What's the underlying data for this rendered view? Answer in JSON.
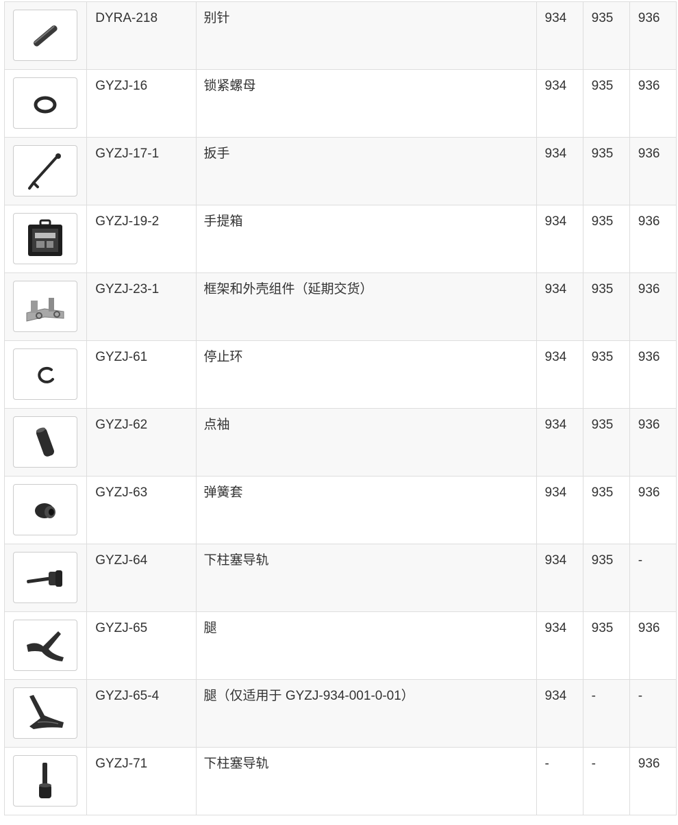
{
  "rows": [
    {
      "code": "DYRA-218",
      "name": "别针",
      "m934": "934",
      "m935": "935",
      "m936": "936",
      "icon": "pin-icon"
    },
    {
      "code": "GYZJ-16",
      "name": "锁紧螺母",
      "m934": "934",
      "m935": "935",
      "m936": "936",
      "icon": "lock-nut-icon"
    },
    {
      "code": "GYZJ-17-1",
      "name": "扳手",
      "m934": "934",
      "m935": "935",
      "m936": "936",
      "icon": "wrench-icon"
    },
    {
      "code": "GYZJ-19-2",
      "name": "手提箱",
      "m934": "934",
      "m935": "935",
      "m936": "936",
      "icon": "carry-case-icon"
    },
    {
      "code": "GYZJ-23-1",
      "name": "框架和外壳组件（延期交货）",
      "m934": "934",
      "m935": "935",
      "m936": "936",
      "icon": "frame-assembly-icon"
    },
    {
      "code": "GYZJ-61",
      "name": "停止环",
      "m934": "934",
      "m935": "935",
      "m936": "936",
      "icon": "stop-ring-icon"
    },
    {
      "code": "GYZJ-62",
      "name": "点袖",
      "m934": "934",
      "m935": "935",
      "m936": "936",
      "icon": "sleeve-icon"
    },
    {
      "code": "GYZJ-63",
      "name": "弹簧套",
      "m934": "934",
      "m935": "935",
      "m936": "936",
      "icon": "spring-sleeve-icon"
    },
    {
      "code": "GYZJ-64",
      "name": "下柱塞导轨",
      "m934": "934",
      "m935": "935",
      "m936": "-",
      "icon": "plunger-guide-icon"
    },
    {
      "code": "GYZJ-65",
      "name": "腿",
      "m934": "934",
      "m935": "935",
      "m936": "936",
      "icon": "leg-icon"
    },
    {
      "code": "GYZJ-65-4",
      "name": "腿（仅适用于 GYZJ-934-001-0-01）",
      "m934": "934",
      "m935": "-",
      "m936": "-",
      "icon": "leg-variant-icon"
    },
    {
      "code": "GYZJ-71",
      "name": "下柱塞导轨",
      "m934": "-",
      "m935": "-",
      "m936": "936",
      "icon": "plunger-guide-vertical-icon"
    }
  ]
}
